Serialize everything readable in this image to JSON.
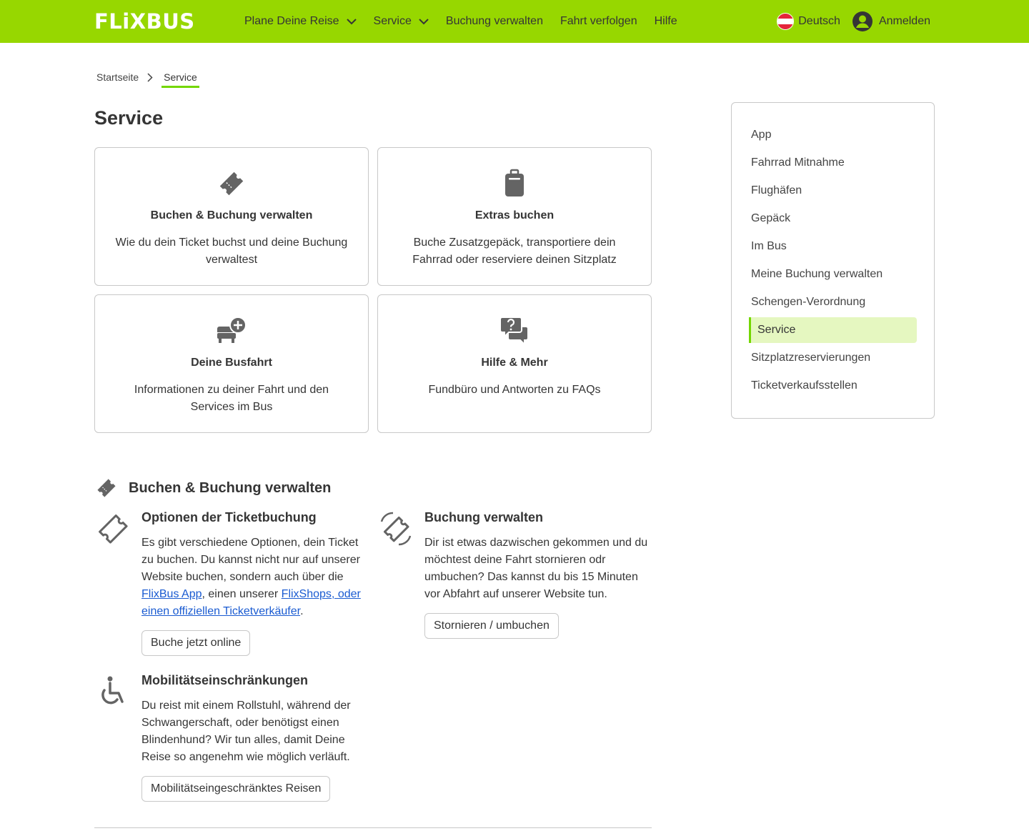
{
  "header": {
    "logo": "FLiXBUS",
    "nav": [
      {
        "label": "Plane Deine Reise",
        "dropdown": true
      },
      {
        "label": "Service",
        "dropdown": true
      },
      {
        "label": "Buchung verwalten",
        "dropdown": false
      },
      {
        "label": "Fahrt verfolgen",
        "dropdown": false
      },
      {
        "label": "Hilfe",
        "dropdown": false
      }
    ],
    "language": "Deutsch",
    "login": "Anmelden"
  },
  "breadcrumb": {
    "home": "Startseite",
    "current": "Service"
  },
  "page_title": "Service",
  "cards": [
    {
      "icon": "ticket-icon",
      "title": "Buchen & Buchung verwalten",
      "desc": "Wie du dein Ticket buchst und deine Buchung verwaltest"
    },
    {
      "icon": "luggage-icon",
      "title": "Extras buchen",
      "desc": "Buche Zusatzgepäck, transportiere dein Fahrrad oder reserviere deinen Sitzplatz"
    },
    {
      "icon": "seat-plus-icon",
      "title": "Deine Busfahrt",
      "desc": "Informationen zu deiner Fahrt und den Services im Bus"
    },
    {
      "icon": "question-bubble-icon",
      "title": "Hilfe & Mehr",
      "desc": "Fundbüro und Antworten zu FAQs"
    }
  ],
  "section": {
    "title": "Buchen & Buchung verwalten",
    "items": [
      {
        "title": "Optionen der Ticketbuchung",
        "text_before": "Es gibt verschiedene Optionen, dein Ticket zu buchen. Du kannst nicht nur auf unserer Website buchen, sondern auch über die ",
        "link1": "FlixBus App",
        "text_mid": ", einen unserer ",
        "link2": "FlixShops, oder einen offiziellen Ticketverkäufer",
        "text_after": ".",
        "button": "Buche jetzt online"
      },
      {
        "title": "Buchung verwalten",
        "text": "Dir ist etwas dazwischen gekommen und du möchtest deine Fahrt stornieren odr umbuchen? Das kannst du bis 15 Minuten vor Abfahrt auf unserer Website tun.",
        "button": "Stornieren / umbuchen"
      },
      {
        "title": "Mobilitätseinschränkungen",
        "text": "Du reist mit einem Rollstuhl, während der Schwangerschaft, oder benötigst einen Blindenhund? Wir tun alles, damit Deine Reise so angenehm wie möglich verläuft.",
        "button": "Mobilitätseingeschränktes Reisen"
      }
    ]
  },
  "sidebar": {
    "items": [
      {
        "label": "App"
      },
      {
        "label": "Fahrrad Mitnahme"
      },
      {
        "label": "Flughäfen"
      },
      {
        "label": "Gepäck"
      },
      {
        "label": "Im Bus"
      },
      {
        "label": "Meine Buchung verwalten"
      },
      {
        "label": "Schengen-Verordnung"
      },
      {
        "label": "Service",
        "active": true
      },
      {
        "label": "Sitzplatzreservierungen"
      },
      {
        "label": "Ticketverkaufsstellen"
      }
    ]
  },
  "colors": {
    "brand_green": "#97d700",
    "accent_green": "#73d700",
    "active_bg": "#e5f7c0",
    "link_blue": "#1a5bd1",
    "icon_gray": "#646464"
  }
}
